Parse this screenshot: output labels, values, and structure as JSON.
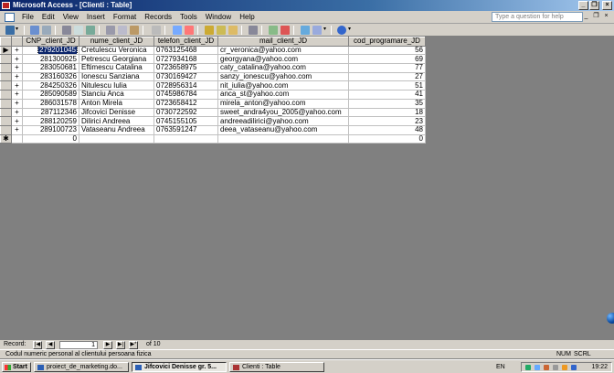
{
  "window": {
    "title": "Microsoft Access - [Clienti : Table]",
    "help_placeholder": "Type a question for help"
  },
  "menu": [
    "File",
    "Edit",
    "View",
    "Insert",
    "Format",
    "Records",
    "Tools",
    "Window",
    "Help"
  ],
  "table": {
    "columns": [
      "CNP_client_JD",
      "nume_client_JD",
      "telefon_client_JD",
      "mail_client_JD",
      "cod_programare_JD"
    ],
    "rows": [
      [
        "279201045",
        "Cretulescu Veronica",
        "0763125468",
        "cr_veronica@yahoo.com",
        "56"
      ],
      [
        "281300925",
        "Petrescu Georgiana",
        "0727934168",
        "georgyana@yahoo.com",
        "69"
      ],
      [
        "283050681",
        "Eftimescu Catalina",
        "0723658975",
        "caty_catalina@yahoo.com",
        "77"
      ],
      [
        "283160326",
        "Ionescu Sanziana",
        "0730169427",
        "sanzy_ionescu@yahoo.com",
        "27"
      ],
      [
        "284250326",
        "Nitulescu Iulia",
        "0728956314",
        "nit_iulia@yahoo.com",
        "51"
      ],
      [
        "285090589",
        "Stanciu Anca",
        "0745986784",
        "anca_st@yahoo.com",
        "41"
      ],
      [
        "286031578",
        "Anton Mirela",
        "0723658412",
        "mirela_anton@yahoo.com",
        "35"
      ],
      [
        "287112346",
        "Jifcovici Denisse",
        "0730722592",
        "sweet_andra4you_2005@yahoo.com",
        "18"
      ],
      [
        "288120259",
        "Dilirici Andreea",
        "0745155105",
        "andreeadilirici@yahoo.com",
        "23"
      ],
      [
        "289100723",
        "Vataseanu Andreea",
        "0763591247",
        "deea_vataseanu@yahoo.com",
        "48"
      ]
    ],
    "new_row": [
      "0",
      "",
      "",
      "",
      "0"
    ],
    "current_row_marker": "▶",
    "new_row_marker": "✱",
    "expand_marker": "+"
  },
  "navigator": {
    "label": "Record:",
    "current": "1",
    "of_text": "of  10"
  },
  "status": {
    "text": "Codul numeric personal al clientului persoana fizica",
    "num": "NUM",
    "scrl": "SCRL"
  },
  "taskbar": {
    "start": "Start",
    "tasks": [
      "proiect_de_marketing.do...",
      "Jifcovici Denisse gr. 5...",
      "Clienti : Table"
    ],
    "lang": "EN",
    "time": "19:22"
  },
  "colors": {
    "title_start": "#0a246a",
    "title_end": "#a6caf0",
    "chrome": "#d4d0c8",
    "workspace": "#808080",
    "selection": "#0a246a"
  }
}
